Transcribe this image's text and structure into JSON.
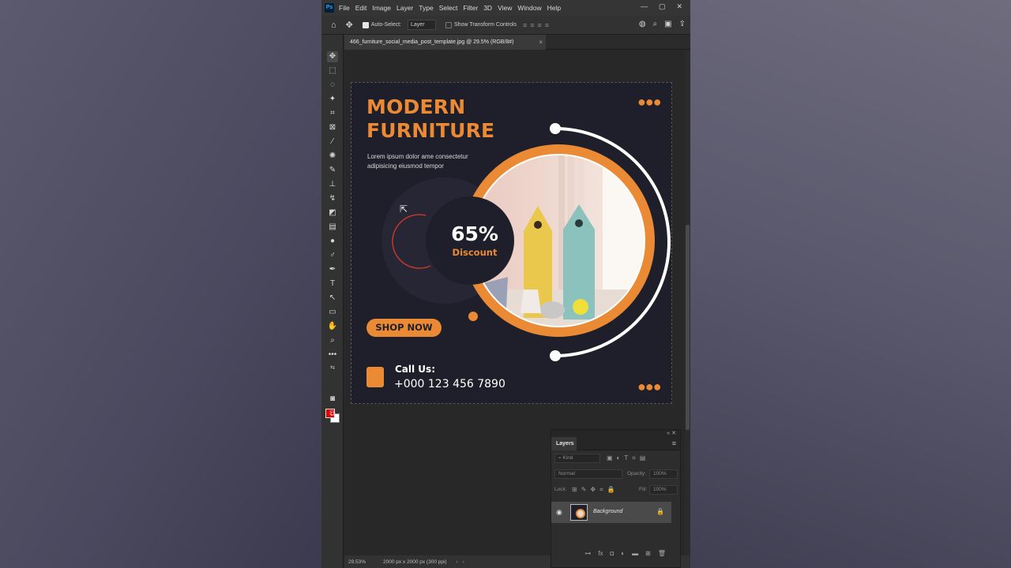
{
  "app": {
    "logo": "Ps",
    "menu": [
      "File",
      "Edit",
      "Image",
      "Layer",
      "Type",
      "Select",
      "Filter",
      "3D",
      "View",
      "Window",
      "Help"
    ],
    "window_controls": [
      "—",
      "▢",
      "✕"
    ]
  },
  "options_bar": {
    "auto_select_label": "Auto-Select:",
    "auto_select_value": "Layer",
    "transform_label": "Show Transform Controls"
  },
  "document": {
    "tab_title": "466_furniture_social_media_post_template.jpg @ 29.5% (RGB/8#)",
    "tab_close": "×",
    "zoom": "29.53%",
    "doc_info": "2000 px x 2000 px (300 ppi)"
  },
  "artwork": {
    "title_line1": "MODERN",
    "title_line2": "FURNITURE",
    "subtitle": "Lorem ipsum dolor ame consectetur adipisicing eiusmod tempor",
    "discount_value": "65%",
    "discount_label": "Discount",
    "cta_label": "SHOP NOW",
    "call_label": "Call Us:",
    "call_number": "+000 123 456 7890",
    "dots": "●●●",
    "accent_color": "#ea8a34",
    "background_color": "#1f1f2b"
  },
  "layers_panel": {
    "tab_label": "Layers",
    "filter_placeholder": "Kind",
    "blend_mode": "Normal",
    "opacity_label": "Opacity:",
    "opacity_value": "100%",
    "lock_label": "Lock:",
    "fill_label": "Fill:",
    "fill_value": "100%",
    "layer_name": "Background"
  }
}
